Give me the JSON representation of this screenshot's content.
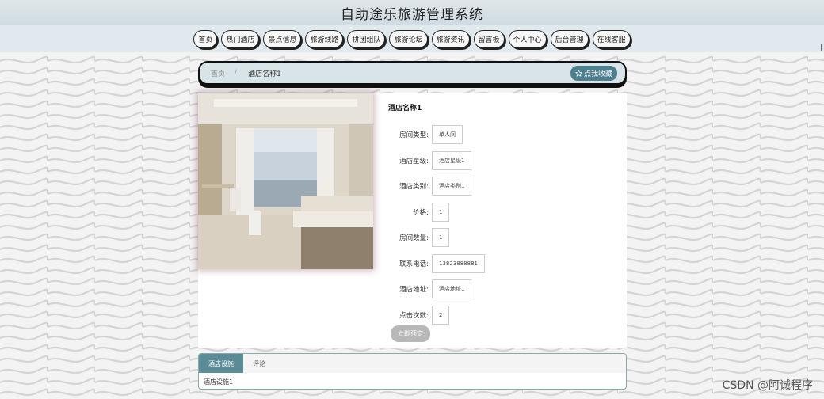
{
  "site": {
    "title": "自助途乐旅游管理系统"
  },
  "nav": {
    "items": [
      {
        "label": "首页"
      },
      {
        "label": "热门酒店"
      },
      {
        "label": "景点信息"
      },
      {
        "label": "旅游线路"
      },
      {
        "label": "拼团组队"
      },
      {
        "label": "旅游论坛"
      },
      {
        "label": "旅游资讯"
      },
      {
        "label": "留言板"
      },
      {
        "label": "个人中心"
      },
      {
        "label": "后台管理"
      },
      {
        "label": "在线客服"
      }
    ]
  },
  "corner_mark": "[",
  "breadcrumb": {
    "home": "首页",
    "separator": "/",
    "current": "酒店名称1",
    "favorite_label": "点我收藏",
    "favorite_icon": "star-icon"
  },
  "hotel": {
    "name": "酒店名称1",
    "fields": [
      {
        "label": "房间类型:",
        "value": "单人间"
      },
      {
        "label": "酒店星级:",
        "value": "酒店星级1"
      },
      {
        "label": "酒店类别:",
        "value": "酒店类别1"
      },
      {
        "label": "价格:",
        "value": "1"
      },
      {
        "label": "房间数量:",
        "value": "1"
      },
      {
        "label": "联系电话:",
        "value": "13823888881"
      },
      {
        "label": "酒店地址:",
        "value": "酒店地址1"
      },
      {
        "label": "点击次数:",
        "value": "2"
      }
    ],
    "book_label": "立即预定"
  },
  "tabs": {
    "items": [
      {
        "label": "酒店设施"
      },
      {
        "label": "评论"
      }
    ],
    "content": "酒店设施1"
  },
  "watermark": "CSDN @阿诚程序",
  "colors": {
    "accent": "#4e7f8f",
    "tab_active": "#5b8b97",
    "nav_bg": "#dfe9ee"
  }
}
